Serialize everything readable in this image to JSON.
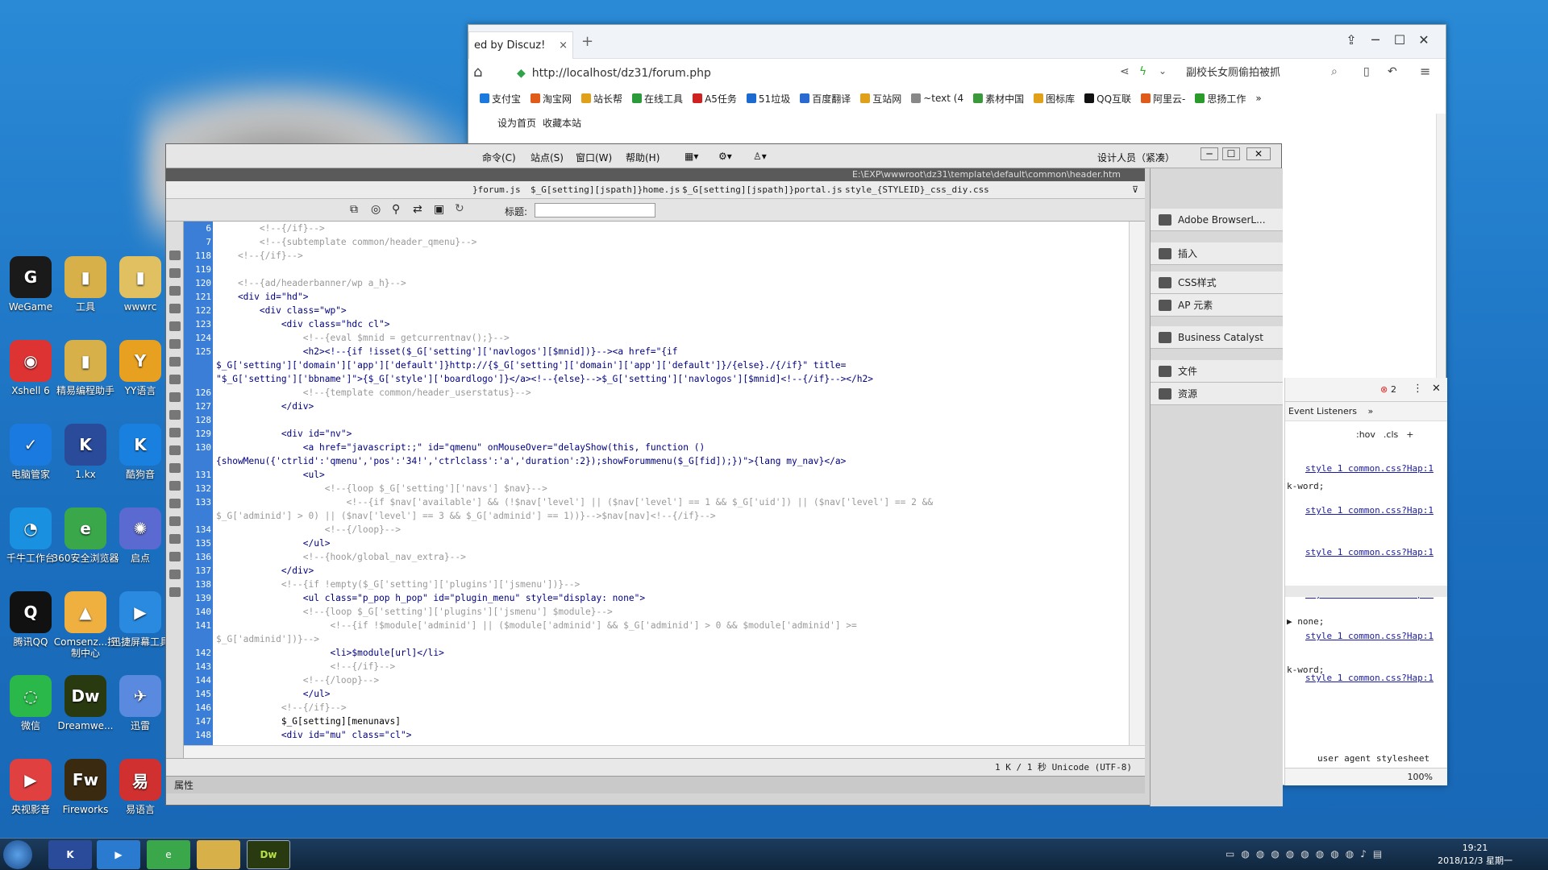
{
  "desktop": {
    "icons": [
      {
        "label": "WeGame",
        "color": "#1a1a1a",
        "glyph": "G"
      },
      {
        "label": "工具",
        "color": "#d8b04a",
        "glyph": "▮"
      },
      {
        "label": "wwwrc",
        "color": "#e0c060",
        "glyph": "▮"
      },
      {
        "label": "Xshell 6",
        "color": "#d33",
        "glyph": "◉"
      },
      {
        "label": "精易编程助手",
        "color": "#d8b04a",
        "glyph": "▮"
      },
      {
        "label": "YY语言",
        "color": "#e8a020",
        "glyph": "Y"
      },
      {
        "label": "电脑管家",
        "color": "#1a7ae0",
        "glyph": "✓"
      },
      {
        "label": "1.kx",
        "color": "#2a4a9a",
        "glyph": "K"
      },
      {
        "label": "酷狗音",
        "color": "#1a80e0",
        "glyph": "K"
      },
      {
        "label": "千牛工作台",
        "color": "#1a90e0",
        "glyph": "◔"
      },
      {
        "label": "360安全浏览器",
        "color": "#3aa84a",
        "glyph": "e"
      },
      {
        "label": "启点",
        "color": "#5a6ad0",
        "glyph": "✺"
      },
      {
        "label": "腾讯QQ",
        "color": "#111",
        "glyph": "Q"
      },
      {
        "label": "Comsenz...控制中心",
        "color": "#f0b040",
        "glyph": "▲"
      },
      {
        "label": "迅捷屏幕工具",
        "color": "#2a8ae0",
        "glyph": "▶"
      },
      {
        "label": "微信",
        "color": "#2ab84a",
        "glyph": "◌"
      },
      {
        "label": "Dreamwe...",
        "color": "#2a3a10",
        "glyph": "Dw"
      },
      {
        "label": "迅雷",
        "color": "#5a8ae0",
        "glyph": "✈"
      },
      {
        "label": "央视影音",
        "color": "#e04040",
        "glyph": "▶"
      },
      {
        "label": "Fireworks",
        "color": "#3a2a10",
        "glyph": "Fw"
      },
      {
        "label": "易语言",
        "color": "#d03030",
        "glyph": "易"
      }
    ]
  },
  "browser": {
    "tab_title": "ed by Discuz!",
    "tab_close": "×",
    "new_tab": "+",
    "url": "http://localhost/dz31/forum.php",
    "search_text": "副校长女厕偷拍被抓",
    "bookmarks": [
      "支付宝",
      "淘宝网",
      "站长帮",
      "在线工具",
      "A5任务",
      "51垃圾",
      "百度翻译",
      "互站网",
      "~text (4",
      "素材中国",
      "图标库",
      "QQ互联",
      "阿里云-",
      "思扬工作"
    ],
    "bookmark_colors": [
      "#1a7ae0",
      "#e05a1a",
      "#e0a01a",
      "#2a9a3a",
      "#d02020",
      "#1a6ad0",
      "#2a6ad0",
      "#e0a01a",
      "#888888",
      "#3a9a3a",
      "#e0a01a",
      "#111111",
      "#e05a1a",
      "#2a9a2a"
    ],
    "page_links": [
      "设为首页",
      "收藏本站"
    ],
    "devtools": {
      "badge": "2",
      "tab": "Event Listeners",
      "filters": [
        ":hov",
        ".cls",
        "+"
      ],
      "links": [
        "style 1 common.css?Hap:1",
        "style 1 common.css?Hap:1",
        "style 1 common.css?Hap:1",
        "style 1 common.css?Hap:1",
        "style 1 common.css?Hap:1",
        "style 1 common.css?Hap:1"
      ],
      "snippets": [
        "k-word;",
        "▶ none;",
        "k-word;",
        "user agent stylesheet"
      ],
      "zoom": "100%"
    }
  },
  "dw": {
    "menus": [
      "命令(C)",
      "站点(S)",
      "窗口(W)",
      "帮助(H)"
    ],
    "workspace": "设计人员（紧凑）",
    "path": "E:\\EXP\\wwwroot\\dz31\\template\\default\\common\\header.htm",
    "files": [
      "}forum.js",
      "$_G[setting][jspath]}home.js",
      "$_G[setting][jspath]}portal.js",
      "style_{STYLEID}_css_diy.css"
    ],
    "title_label": "标题:",
    "status": "1 K / 1 秒  Unicode (UTF-8)",
    "prop_label": "属性",
    "panels": [
      "Adobe BrowserL...",
      "插入",
      "CSS样式",
      "AP 元素",
      "Business Catalyst",
      "文件",
      "资源"
    ],
    "code": [
      {
        "n": "6",
        "t": "        <!--{/if}-->",
        "c": "cm"
      },
      {
        "n": "7",
        "t": "        <!--{subtemplate common/header_qmenu}-->",
        "c": "cm"
      },
      {
        "n": "118",
        "t": "    <!--{/if}-->",
        "c": "cm"
      },
      {
        "n": "119",
        "t": "",
        "c": "st"
      },
      {
        "n": "120",
        "t": "    <!--{ad/headerbanner/wp a_h}-->",
        "c": "cm"
      },
      {
        "n": "121",
        "t": "    <div id=\"hd\">",
        "c": "tg"
      },
      {
        "n": "122",
        "t": "        <div class=\"wp\">",
        "c": "tg"
      },
      {
        "n": "123",
        "t": "            <div class=\"hdc cl\">",
        "c": "tg"
      },
      {
        "n": "124",
        "t": "                <!--{eval $mnid = getcurrentnav();}-->",
        "c": "cm"
      },
      {
        "n": "125",
        "t": "                <h2><!--{if !isset($_G['setting']['navlogos'][$mnid])}--><a href=\"{if",
        "c": "tg"
      },
      {
        "n": "",
        "t": "$_G['setting']['domain']['app']['default']}http://{$_G['setting']['domain']['app']['default']}/{else}./{/if}\" title=",
        "c": "tg"
      },
      {
        "n": "",
        "t": "\"$_G['setting']['bbname']\">{$_G['style']['boardlogo']}</a><!--{else}-->$_G['setting']['navlogos'][$mnid]<!--{/if}--></h2>",
        "c": "tg"
      },
      {
        "n": "126",
        "t": "                <!--{template common/header_userstatus}-->",
        "c": "cm"
      },
      {
        "n": "127",
        "t": "            </div>",
        "c": "tg"
      },
      {
        "n": "128",
        "t": "",
        "c": "st"
      },
      {
        "n": "129",
        "t": "            <div id=\"nv\">",
        "c": "tg"
      },
      {
        "n": "130",
        "t": "                <a href=\"javascript:;\" id=\"qmenu\" onMouseOver=\"delayShow(this, function ()",
        "c": "tg"
      },
      {
        "n": "",
        "t": "{showMenu({'ctrlid':'qmenu','pos':'34!','ctrlclass':'a','duration':2});showForummenu($_G[fid]);})\">{lang my_nav}</a>",
        "c": "tg"
      },
      {
        "n": "131",
        "t": "                <ul>",
        "c": "tg"
      },
      {
        "n": "132",
        "t": "                    <!--{loop $_G['setting']['navs'] $nav}-->",
        "c": "cm"
      },
      {
        "n": "133",
        "t": "                        <!--{if $nav['available'] && (!$nav['level'] || ($nav['level'] == 1 && $_G['uid']) || ($nav['level'] == 2 &&",
        "c": "cm"
      },
      {
        "n": "",
        "t": "$_G['adminid'] > 0) || ($nav['level'] == 3 && $_G['adminid'] == 1))}-->$nav[nav]<!--{/if}-->",
        "c": "cm"
      },
      {
        "n": "134",
        "t": "                    <!--{/loop}-->",
        "c": "cm"
      },
      {
        "n": "135",
        "t": "                </ul>",
        "c": "tg"
      },
      {
        "n": "136",
        "t": "                <!--{hook/global_nav_extra}-->",
        "c": "cm"
      },
      {
        "n": "137",
        "t": "            </div>",
        "c": "tg"
      },
      {
        "n": "138",
        "t": "            <!--{if !empty($_G['setting']['plugins']['jsmenu'])}-->",
        "c": "cm"
      },
      {
        "n": "139",
        "t": "                <ul class=\"p_pop h_pop\" id=\"plugin_menu\" style=\"display: none\">",
        "c": "tg"
      },
      {
        "n": "140",
        "t": "                <!--{loop $_G['setting']['plugins']['jsmenu'] $module}-->",
        "c": "cm"
      },
      {
        "n": "141",
        "t": "                     <!--{if !$module['adminid'] || ($module['adminid'] && $_G['adminid'] > 0 && $module['adminid'] >=",
        "c": "cm"
      },
      {
        "n": "",
        "t": "$_G['adminid'])}-->",
        "c": "cm"
      },
      {
        "n": "142",
        "t": "                     <li>$module[url]</li>",
        "c": "tg"
      },
      {
        "n": "143",
        "t": "                     <!--{/if}-->",
        "c": "cm"
      },
      {
        "n": "144",
        "t": "                <!--{/loop}-->",
        "c": "cm"
      },
      {
        "n": "145",
        "t": "                </ul>",
        "c": "tg"
      },
      {
        "n": "146",
        "t": "            <!--{/if}-->",
        "c": "cm"
      },
      {
        "n": "147",
        "t": "            $_G[setting][menunavs]",
        "c": "st"
      },
      {
        "n": "148",
        "t": "            <div id=\"mu\" class=\"cl\">",
        "c": "tg"
      }
    ]
  },
  "taskbar": {
    "time": "19:21",
    "date": "2018/12/3 星期一",
    "apps": [
      "start",
      "kx",
      "video",
      "360",
      "folder",
      "Dw"
    ]
  }
}
